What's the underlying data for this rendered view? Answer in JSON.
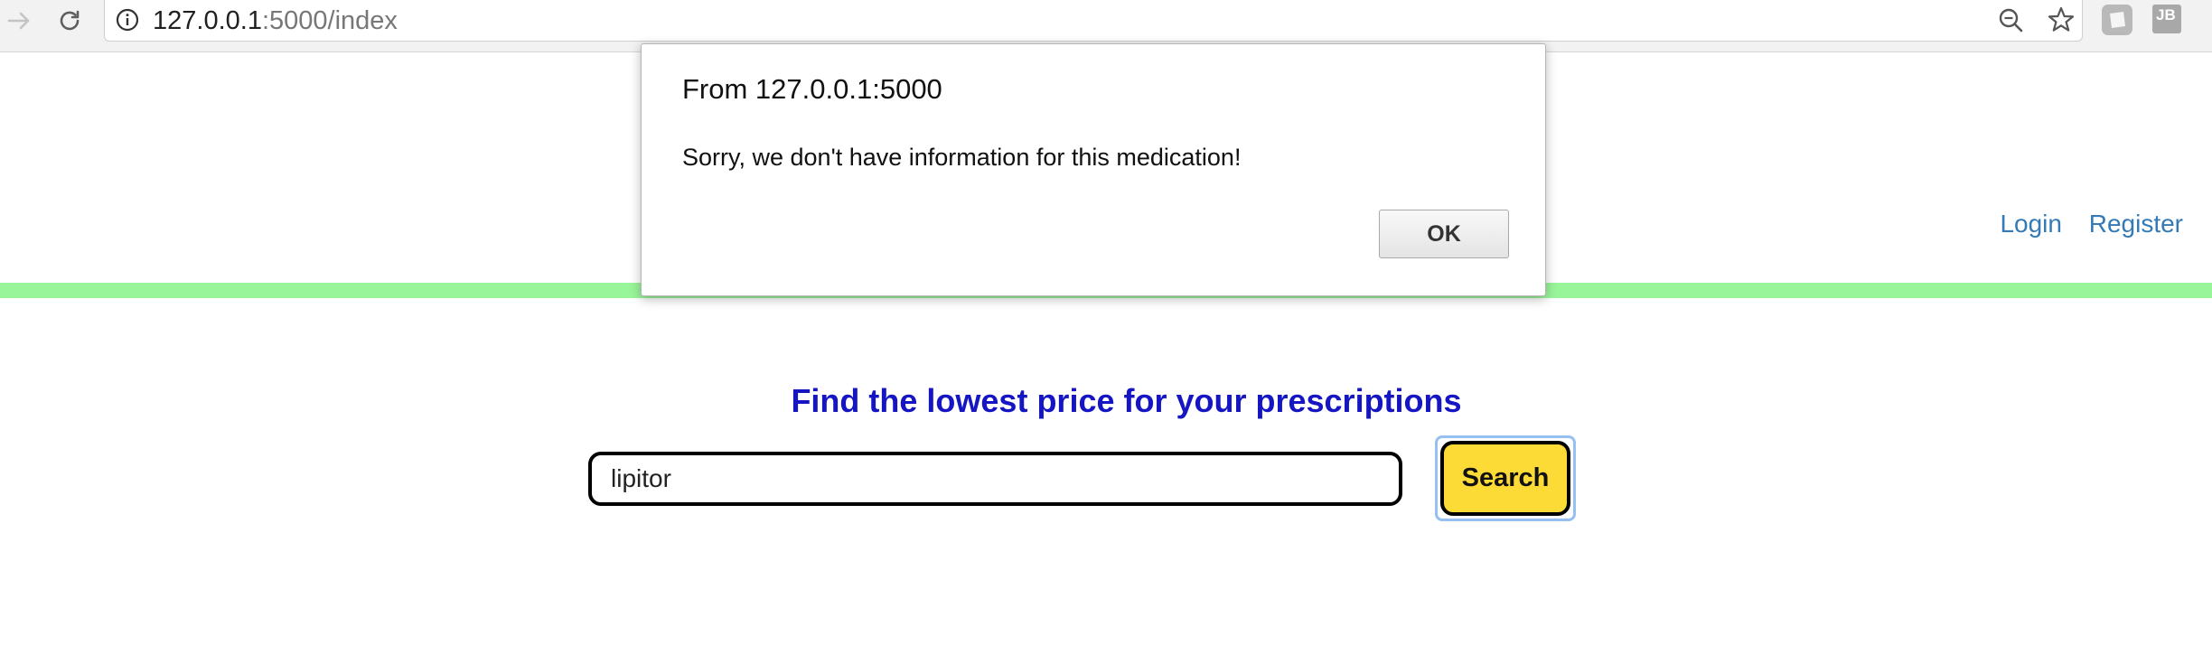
{
  "browser": {
    "url_host": "127.0.0.1",
    "url_rest": ":5000/index",
    "extension_label": "JB"
  },
  "header": {
    "login_label": "Login",
    "register_label": "Register"
  },
  "main": {
    "headline": "Find the lowest price for your prescriptions",
    "search_value": "lipitor",
    "search_button_label": "Search"
  },
  "dialog": {
    "title": "From 127.0.0.1:5000",
    "message": "Sorry, we don't have information for this medication!",
    "ok_label": "OK"
  },
  "icons": {
    "forward": "forward-arrow-icon",
    "reload": "reload-icon",
    "info": "info-icon",
    "zoom": "zoom-out-icon",
    "bookmark": "star-icon",
    "extension_1": "extension-icon",
    "extension_2": "jetbrains-extension-icon"
  },
  "colors": {
    "accent_bar": "#99f599",
    "headline": "#1515c4",
    "link": "#337ab7",
    "search_button": "#fddb36"
  }
}
